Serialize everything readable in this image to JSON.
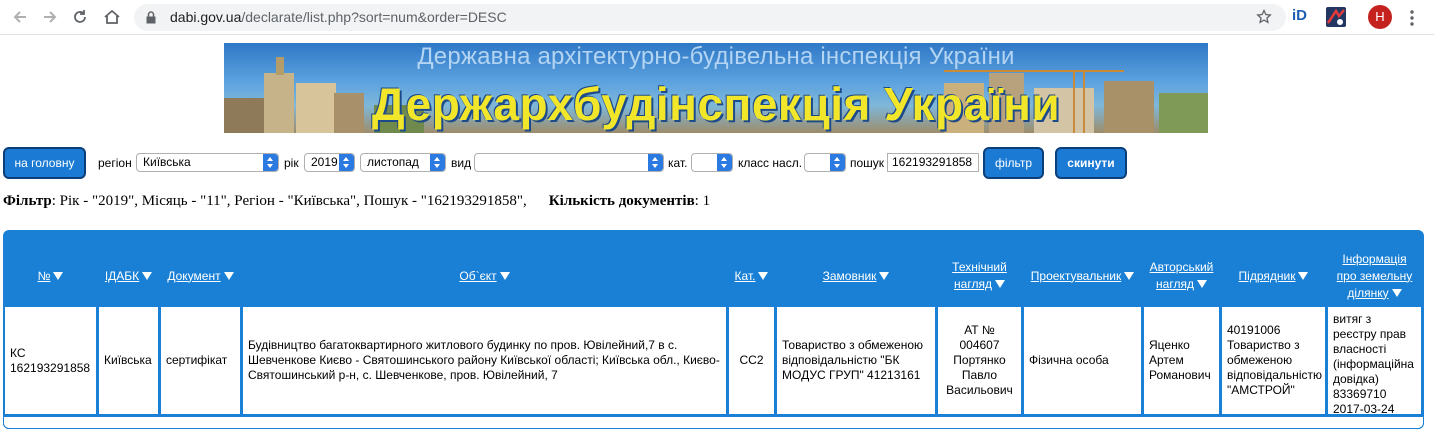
{
  "browser": {
    "url_host": "dabi.gov.ua",
    "url_path": "/declarate/list.php?sort=num&order=DESC",
    "ext_id_label": "iD",
    "avatar_letter": "H"
  },
  "banner": {
    "subtitle": "Державна архітектурно-будівельна інспекція України",
    "title": "Держархбудінспекція України"
  },
  "filters": {
    "home_button": "на головну",
    "region_label": "регіон",
    "region_value": "Київська",
    "year_label": "рік",
    "year_value": "2019",
    "month_value": "листопад",
    "type_label": "вид",
    "type_value": "",
    "cat_label": "кат.",
    "cat_value": "",
    "class_label": "класс насл.",
    "class_value": "",
    "search_label": "пошук",
    "search_value": "162193291858",
    "filter_button": "фільтр",
    "reset_button": "скинути"
  },
  "summary": {
    "filter_label": "Фільтр",
    "filter_text": ": Рік - \"2019\", Місяць - \"11\", Регіон - \"Київська\", Пошук - \"162193291858\",",
    "count_label": "Кількість документів",
    "count_text": ": 1"
  },
  "table": {
    "headers": {
      "num": "№",
      "idabk": "ІДАБК",
      "document": "Документ",
      "object": "Об`єкт",
      "cat": "Кат.",
      "customer": "Замовник",
      "tech_supervision_1": "Технічний",
      "tech_supervision_2": "нагляд",
      "designer": "Проектувальник",
      "author_supervision_1": "Авторський",
      "author_supervision_2": "нагляд",
      "contractor": "Підрядник",
      "land_info_1": "Інформація",
      "land_info_2": "про земельну",
      "land_info_3": "ділянку"
    },
    "rows": [
      {
        "num": "КС 162193291858",
        "idabk": "Київська",
        "document": "сертифікат",
        "object": "Будівництво багатоквартирного житлового будинку по пров. Ювілейний,7 в с. Шевченкове Києво - Святошинського району Київської області; Київська обл., Києво-Святошинський р-н, с. Шевченкове, пров. Ювілейний, 7",
        "cat": "СС2",
        "customer": "Товариство з обмеженою відповідальністю \"БК МОДУС ГРУП\" 41213161",
        "tech_supervision": "АТ № 004607 Портянко Павло Васильович",
        "designer": "Фізична особа",
        "author_supervision": "Яценко Артем Романович",
        "contractor": "40191006 Товариство з обмеженою відповідальністю \"АМСТРОЙ\"",
        "land_info": "витяг з реєстру прав власності (інформаційна довідка) 83369710 2017-03-24"
      }
    ]
  }
}
